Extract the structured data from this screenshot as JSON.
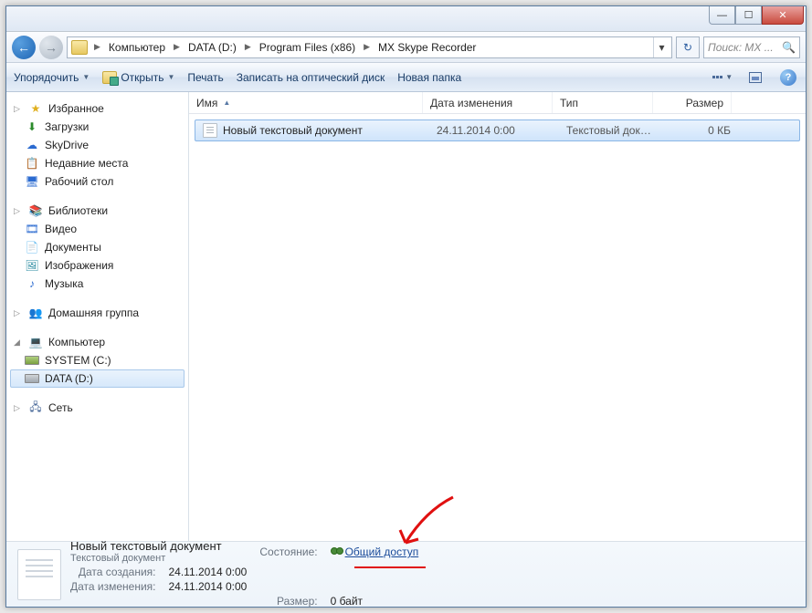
{
  "titlebar": {
    "min": "—",
    "max": "☐",
    "close": "✕"
  },
  "nav": {
    "back": "←",
    "fwd": "→",
    "crumbs": [
      "Компьютер",
      "DATA (D:)",
      "Program Files (x86)",
      "MX Skype Recorder"
    ],
    "refresh": "↻",
    "search_placeholder": "Поиск: MX ..."
  },
  "toolbar": {
    "organize": "Упорядочить",
    "open": "Открыть",
    "print": "Печать",
    "burn": "Записать на оптический диск",
    "newfolder": "Новая папка"
  },
  "sidebar": {
    "fav": {
      "head": "Избранное",
      "items": [
        "Загрузки",
        "SkyDrive",
        "Недавние места",
        "Рабочий стол"
      ]
    },
    "lib": {
      "head": "Библиотеки",
      "items": [
        "Видео",
        "Документы",
        "Изображения",
        "Музыка"
      ]
    },
    "home": "Домашняя группа",
    "comp": {
      "head": "Компьютер",
      "items": [
        "SYSTEM (C:)",
        "DATA (D:)"
      ]
    },
    "net": "Сеть"
  },
  "columns": {
    "name": "Имя",
    "date": "Дата изменения",
    "type": "Тип",
    "size": "Размер"
  },
  "files": [
    {
      "name": "Новый текстовый документ",
      "date": "24.11.2014 0:00",
      "type": "Текстовый докум...",
      "size": "0 КБ"
    }
  ],
  "details": {
    "name": "Новый текстовый документ",
    "type": "Текстовый документ",
    "state_lbl": "Состояние:",
    "state_val": "Общий доступ",
    "created_lbl": "Дата создания:",
    "created_val": "24.11.2014 0:00",
    "modified_lbl": "Дата изменения:",
    "modified_val": "24.11.2014 0:00",
    "size_lbl": "Размер:",
    "size_val": "0 байт"
  }
}
